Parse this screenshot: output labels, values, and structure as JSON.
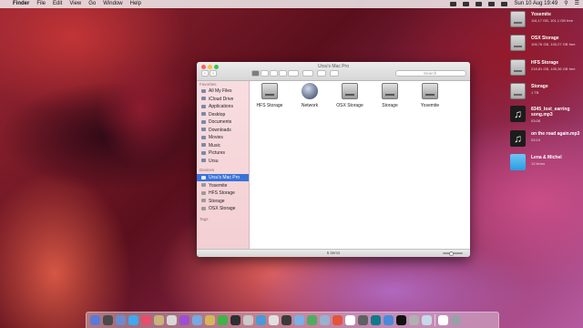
{
  "menubar": {
    "apple": "",
    "app": "Finder",
    "items": [
      "File",
      "Edit",
      "View",
      "Go",
      "Window",
      "Help"
    ],
    "clock": "Sun 10 Aug  19:49"
  },
  "desktop": [
    {
      "name": "Yosemite",
      "sub": "116,17 GB, 101,1 GB free",
      "kind": "disk",
      "icon": "hard-drive-icon"
    },
    {
      "name": "OSX Storage",
      "sub": "106,76 GB, 100,27 GB free",
      "kind": "disk",
      "icon": "hard-drive-icon"
    },
    {
      "name": "HFS Storage",
      "sub": "218,81 GB, 105,36 GB free",
      "kind": "disk",
      "icon": "hard-drive-icon"
    },
    {
      "name": "Storage",
      "sub": "1 TB",
      "kind": "disk",
      "icon": "hard-drive-icon"
    },
    {
      "name": "8345_lost_earring song.mp3",
      "sub": "03:08",
      "kind": "music",
      "icon": "music-file-icon"
    },
    {
      "name": "on the road again.mp3",
      "sub": "03:19",
      "kind": "music",
      "icon": "music-file-icon"
    },
    {
      "name": "Lena & Michel",
      "sub": "12 items",
      "kind": "folder",
      "icon": "folder-icon"
    }
  ],
  "window": {
    "title": "Ursu's Mac Pro",
    "search_placeholder": "Search",
    "status": "5 items",
    "sidebar": {
      "favorites_label": "Favorites",
      "favorites": [
        "All My Files",
        "iCloud Drive",
        "Applications",
        "Desktop",
        "Documents",
        "Downloads",
        "Movies",
        "Music",
        "Pictures",
        "Ursu"
      ],
      "devices_label": "Devices",
      "devices": [
        "Ursu's Mac Pro",
        "Yosemite",
        "HFS Storage",
        "Storage",
        "OSX Storage"
      ],
      "selected_device": "Ursu's Mac Pro",
      "tags_label": "Tags"
    },
    "files": [
      {
        "label": "HFS Storage",
        "kind": "hdd"
      },
      {
        "label": "Network",
        "kind": "network"
      },
      {
        "label": "OSX Storage",
        "kind": "hdd"
      },
      {
        "label": "Storage",
        "kind": "hdd"
      },
      {
        "label": "Yosemite",
        "kind": "hdd"
      }
    ]
  },
  "dock": {
    "apps": [
      "#5b7bd8",
      "#4a4a4a",
      "#6b8bd0",
      "#3fa8f0",
      "#e84d6b",
      "#cbb27a",
      "#d8d8d8",
      "#9f4fd0",
      "#7aa8e0",
      "#d7b55a",
      "#3fb24a",
      "#2f2f2f",
      "#c9c9c9",
      "#4a9ad8",
      "#e0e0e0",
      "#3b3b3b",
      "#7ab0e8",
      "#4faa62",
      "#9ab0d0",
      "#e5533b",
      "#ffffff",
      "#606060",
      "#0f7a8a",
      "#4a8ad8",
      "#111111",
      "#b0b0b0",
      "#c9d8e8",
      "#ffffff",
      "#9aa0a8"
    ]
  }
}
